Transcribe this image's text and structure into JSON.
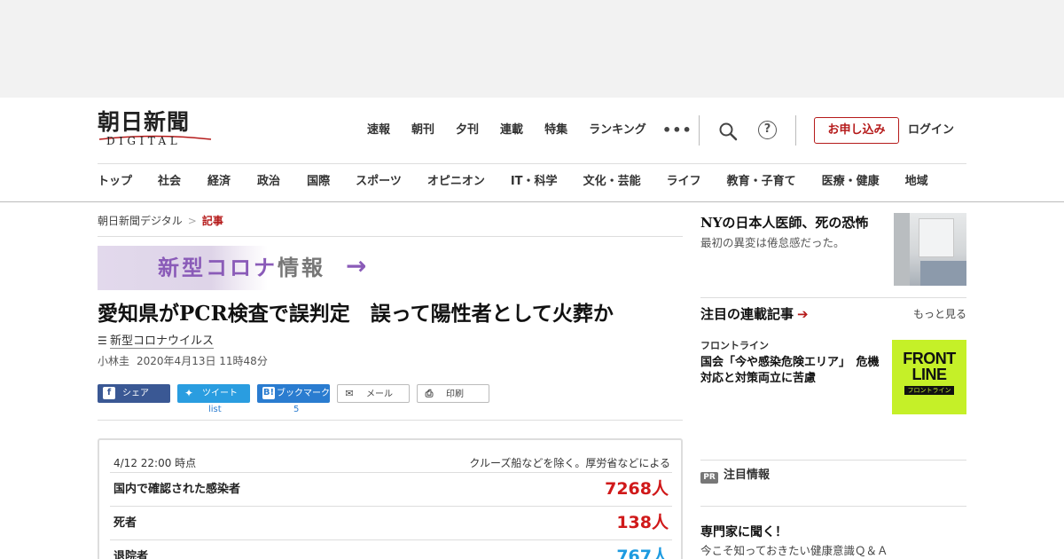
{
  "header": {
    "logo_main": "朝日新聞",
    "logo_sub": "DIGITAL",
    "topnav": [
      "速報",
      "朝刊",
      "夕刊",
      "連載",
      "特集",
      "ランキング"
    ],
    "more_dots": "•••",
    "help_glyph": "?",
    "apply_label": "お申し込み",
    "login_label": "ログイン",
    "categories": [
      "トップ",
      "社会",
      "経済",
      "政治",
      "国際",
      "スポーツ",
      "オピニオン",
      "IT・科学",
      "文化・芸能",
      "ライフ",
      "教育・子育て",
      "医療・健康",
      "地域"
    ]
  },
  "breadcrumb": {
    "home": "朝日新聞デジタル",
    "sep": ">",
    "current": "記事"
  },
  "banner": {
    "text_colored": "新型コロナ",
    "text_gray": "情報",
    "arrow": "→"
  },
  "article": {
    "headline": "愛知県がPCR検査で誤判定　誤って陽性者として火葬か",
    "topic": "新型コロナウイルス",
    "author": "小林圭",
    "date": "2020年4月13日 11時48分"
  },
  "share": {
    "facebook": "シェア",
    "twitter": "ツイート",
    "hatena": "ブックマーク",
    "mail": "メール",
    "print": "印刷",
    "twitter_count": "list",
    "hatena_count": "5"
  },
  "stats": {
    "as_of": "4/12 22:00 時点",
    "note": "クルーズ船などを除く。厚労省などによる",
    "rows": [
      {
        "label": "国内で確認された感染者",
        "value": "7268人",
        "color": "#d0191a"
      },
      {
        "label": "死者",
        "value": "138人",
        "color": "#d0191a"
      },
      {
        "label": "退院者",
        "value": "767人",
        "color": "#1e9be0"
      }
    ]
  },
  "sidebar": {
    "lead_title": "NYの日本人医師、死の恐怖",
    "lead_sub": "最初の異変は倦怠感だった。",
    "series_title": "注目の連載記事",
    "series_arrow": "➔",
    "series_more": "もっと見る",
    "series_category": "フロントライン",
    "series_item_title": "国会「今や感染危険エリア」　危機対応と対策両立に苦慮",
    "badge_line1": "FRONT",
    "badge_line2": "LINE",
    "badge_caption": "フロントライン",
    "pr_icon": "PR",
    "pr_label": "注目情報",
    "expert_title": "専門家に聞く！",
    "expert_sub": "今こそ知っておきたい健康意識Ｑ＆Ａ"
  }
}
